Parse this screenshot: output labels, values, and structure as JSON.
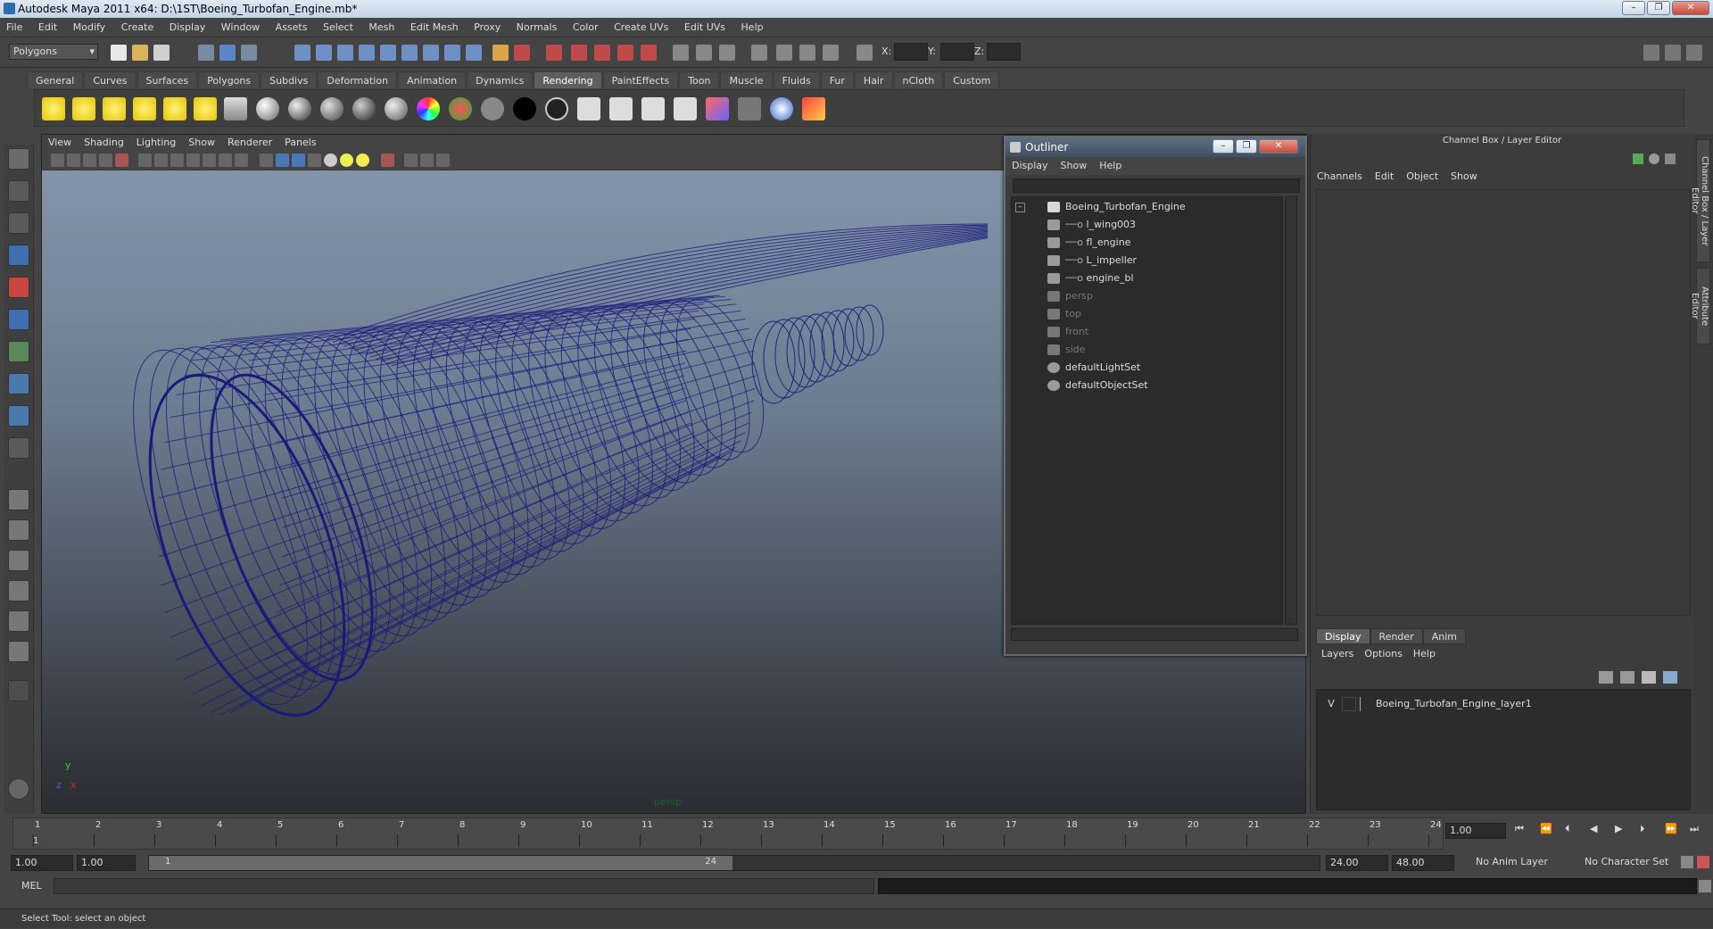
{
  "window": {
    "title": "Autodesk Maya 2011 x64: D:\\1ST\\Boeing_Turbofan_Engine.mb*",
    "minimize": "–",
    "restore": "❐",
    "close": "✕"
  },
  "menubar": [
    "File",
    "Edit",
    "Modify",
    "Create",
    "Display",
    "Window",
    "Assets",
    "Select",
    "Mesh",
    "Edit Mesh",
    "Proxy",
    "Normals",
    "Color",
    "Create UVs",
    "Edit UVs",
    "Help"
  ],
  "statusline": {
    "mode": "Polygons",
    "x_label": "X:",
    "y_label": "Y:",
    "z_label": "Z:"
  },
  "shelf_tabs": [
    "General",
    "Curves",
    "Surfaces",
    "Polygons",
    "Subdivs",
    "Deformation",
    "Animation",
    "Dynamics",
    "Rendering",
    "PaintEffects",
    "Toon",
    "Muscle",
    "Fluids",
    "Fur",
    "Hair",
    "nCloth",
    "Custom"
  ],
  "shelf_active_tab": "Rendering",
  "viewport": {
    "menu": [
      "View",
      "Shading",
      "Lighting",
      "Show",
      "Renderer",
      "Panels"
    ],
    "camera_label": "persp",
    "axis_y": "y",
    "axis_x": "x",
    "axis_z": "z",
    "wire_color": "#1a1a7a"
  },
  "outliner": {
    "title": "Outliner",
    "menu": [
      "Display",
      "Show",
      "Help"
    ],
    "items": [
      {
        "label": "Boeing_Turbofan_Engine",
        "indent": 0,
        "state": "bright",
        "expander": "–"
      },
      {
        "label": "l_wing003",
        "indent": 1,
        "state": "bright"
      },
      {
        "label": "fl_engine",
        "indent": 1,
        "state": "bright"
      },
      {
        "label": "L_impeller",
        "indent": 1,
        "state": "bright"
      },
      {
        "label": "engine_bl",
        "indent": 1,
        "state": "bright"
      },
      {
        "label": "persp",
        "indent": 0,
        "state": "dim"
      },
      {
        "label": "top",
        "indent": 0,
        "state": "dim"
      },
      {
        "label": "front",
        "indent": 0,
        "state": "dim"
      },
      {
        "label": "side",
        "indent": 0,
        "state": "dim"
      },
      {
        "label": "defaultLightSet",
        "indent": 0,
        "state": "bright"
      },
      {
        "label": "defaultObjectSet",
        "indent": 0,
        "state": "bright"
      }
    ]
  },
  "channelbox": {
    "title": "Channel Box / Layer Editor",
    "menu": [
      "Channels",
      "Edit",
      "Object",
      "Show"
    ],
    "layer_tabs": [
      "Display",
      "Render",
      "Anim"
    ],
    "layer_active_tab": "Display",
    "layer_menu": [
      "Layers",
      "Options",
      "Help"
    ],
    "layer": {
      "visible": "V",
      "name": "Boeing_Turbofan_Engine_layer1"
    }
  },
  "side_tabs": [
    "Channel Box / Layer Editor",
    "Attribute Editor"
  ],
  "timeslider": {
    "ticks": [
      "1",
      "2",
      "3",
      "4",
      "5",
      "6",
      "7",
      "8",
      "9",
      "10",
      "11",
      "12",
      "13",
      "14",
      "15",
      "16",
      "17",
      "18",
      "19",
      "20",
      "21",
      "22",
      "23",
      "24"
    ],
    "current_frame_marker": "1",
    "current_time": "1.00"
  },
  "range": {
    "start_time": "1.00",
    "playback_start": "1.00",
    "range_start_label": "1",
    "range_end_label": "24",
    "playback_end": "24.00",
    "end_time": "48.00",
    "anim_layer": "No Anim Layer",
    "character_set": "No Character Set"
  },
  "cmdline": {
    "label": "MEL"
  },
  "helpline": {
    "text": "Select Tool: select an object"
  },
  "colors": {
    "accent": "#5e5e5e",
    "title_blue": "#2e6bb0",
    "close_red": "#c64a3a"
  }
}
